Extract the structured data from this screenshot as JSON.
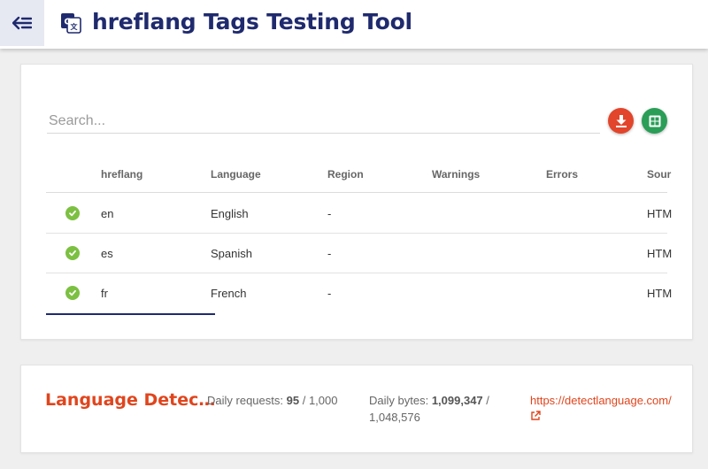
{
  "header": {
    "title": "hreflang Tags Testing Tool",
    "back_icon": "back-arrow-icon",
    "app_icon": "translate-icon"
  },
  "search": {
    "placeholder": "Search..."
  },
  "actions": {
    "download_icon": "download-icon",
    "sheets_icon": "google-sheets-icon"
  },
  "table": {
    "columns": [
      "hreflang",
      "Language",
      "Region",
      "Warnings",
      "Errors",
      "Sour"
    ],
    "rows": [
      {
        "hreflang": "en",
        "language": "English",
        "region": "-",
        "warnings": "",
        "errors": "",
        "source": "HTM"
      },
      {
        "hreflang": "es",
        "language": "Spanish",
        "region": "-",
        "warnings": "",
        "errors": "",
        "source": "HTM"
      },
      {
        "hreflang": "fr",
        "language": "French",
        "region": "-",
        "warnings": "",
        "errors": "",
        "source": "HTM"
      }
    ]
  },
  "language_detection": {
    "title": "Language Detec…",
    "daily_requests_label": "Daily requests:",
    "daily_requests_used": "95",
    "daily_requests_limit": "1,000",
    "daily_bytes_label": "Daily bytes:",
    "daily_bytes_used": "1,099,347",
    "daily_bytes_limit": "1,048,576",
    "link": "https://detectlanguage.com/"
  },
  "colors": {
    "brand": "#1f2a6e",
    "accent": "#e0451d",
    "success": "#7cc042",
    "sheets": "#2a9d57"
  }
}
